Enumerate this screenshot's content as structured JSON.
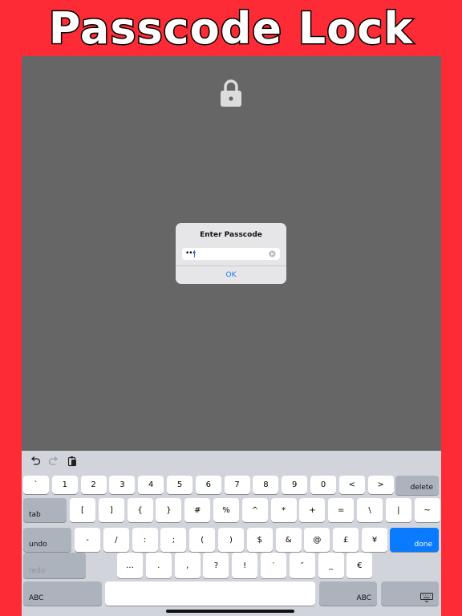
{
  "banner": {
    "title": "Passcode Lock"
  },
  "dialog": {
    "title": "Enter Passcode",
    "password_value": "•••",
    "ok_label": "OK"
  },
  "keyboard": {
    "toolbar": {
      "icons": [
        "undo-icon",
        "redo-icon",
        "paste-icon"
      ]
    },
    "row1": [
      "`",
      "1",
      "2",
      "3",
      "4",
      "5",
      "6",
      "7",
      "8",
      "9",
      "0",
      "<",
      ">"
    ],
    "delete_label": "delete",
    "tab_label": "tab",
    "row2": [
      "[",
      "]",
      "{",
      "}",
      "#",
      "%",
      "^",
      "*",
      "+",
      "=",
      "\\",
      "|",
      "~"
    ],
    "undo_label": "undo",
    "row3": [
      "-",
      "/",
      ":",
      ";",
      "(",
      ")",
      "$",
      "&",
      "@",
      "£",
      "¥"
    ],
    "done_label": "done",
    "redo_label": "redo",
    "row4": [
      "…",
      ".",
      ",",
      "?",
      "!",
      "′",
      "″",
      "_",
      "€"
    ],
    "abc_left_label": "ABC",
    "abc_right_label": "ABC",
    "hide_keyboard_icon": "keyboard-icon",
    "colors": {
      "done": "#0a7aff",
      "dark_key": "#adb3bc",
      "background": "#d1d4db"
    }
  },
  "colors": {
    "banner": "#fc2b36",
    "screen": "#666666",
    "accent": "#1a7cf5"
  }
}
